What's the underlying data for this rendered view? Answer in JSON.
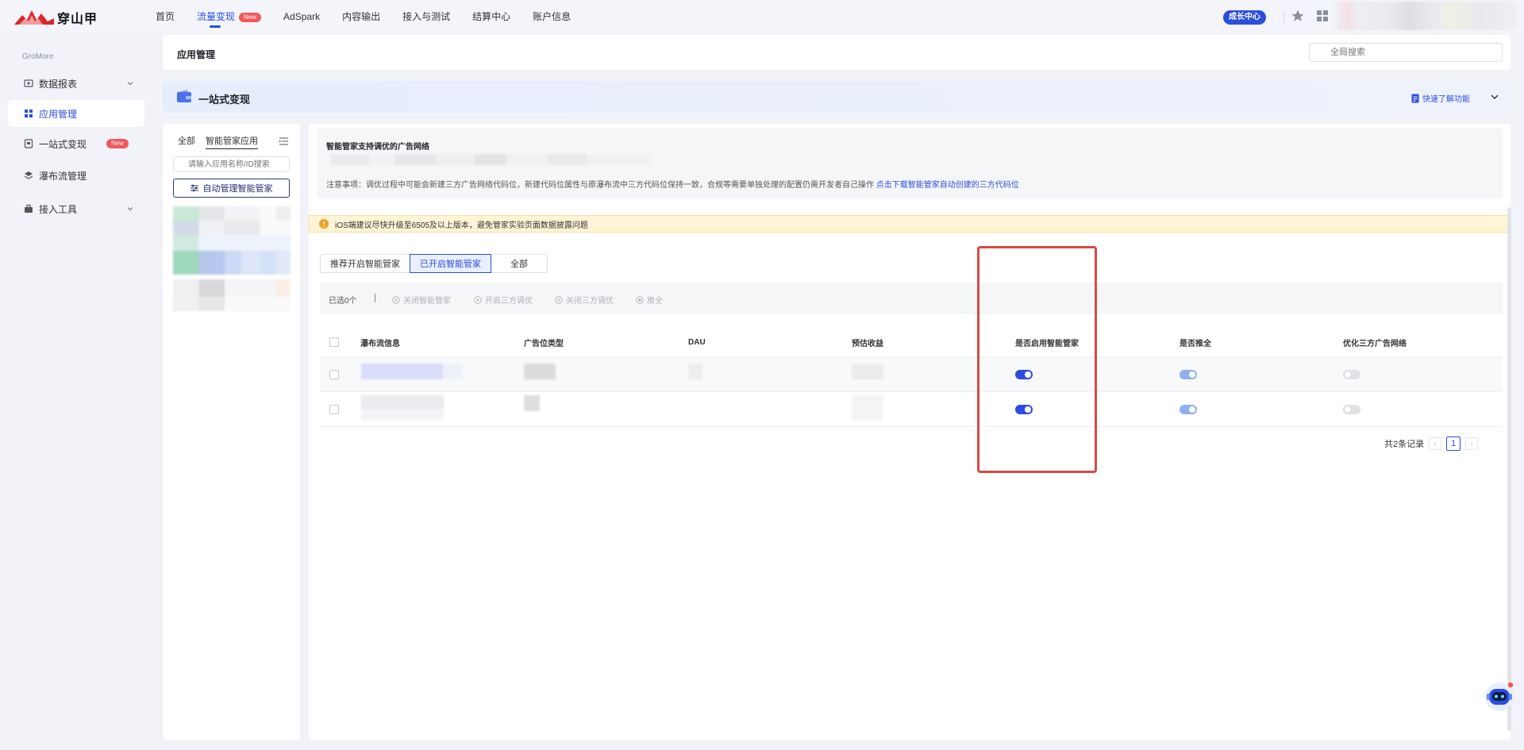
{
  "brand": {
    "name": "穿山甲"
  },
  "nav": {
    "items": [
      "首页",
      "流量变现",
      "AdSpark",
      "内容输出",
      "接入与测试",
      "结算中心",
      "账户信息"
    ],
    "new_badge": "New",
    "growth_center": "成长中心"
  },
  "sidebar": {
    "group": "GroMore",
    "items": [
      {
        "label": "数据报表",
        "icon": "chart-icon"
      },
      {
        "label": "应用管理",
        "icon": "grid-icon"
      },
      {
        "label": "一站式变现",
        "icon": "wallet-icon",
        "badge": "New"
      },
      {
        "label": "瀑布流管理",
        "icon": "layers-icon"
      },
      {
        "label": "接入工具",
        "icon": "toolbox-icon"
      }
    ]
  },
  "header": {
    "title": "应用管理",
    "search_placeholder": "全局搜索"
  },
  "one_stop": {
    "title": "一站式变现",
    "quick_link": "快速了解功能"
  },
  "left_panel": {
    "tabs": [
      "全部",
      "智能管家应用"
    ],
    "search_placeholder": "请输入应用名称/ID搜索",
    "auto_button": "自动管理智能管家"
  },
  "info": {
    "title": "智能管家支持调优的广告网络",
    "note": "注意事项：调优过程中可能会新建三方广告网络代码位，新建代码位属性与原瀑布流中三方代码位保持一致，合规等需要单独处理的配置仍需开发者自己操作",
    "note_link": "点击下载智能管家自动创建的三方代码位"
  },
  "warning": {
    "text": "iOS端建议尽快升级至6505及以上版本，避免管家实验页面数据披露问题"
  },
  "filter_tabs": {
    "items": [
      "推荐开启智能管家",
      "已开启智能管家",
      "全部"
    ],
    "active": 1
  },
  "bulk": {
    "selected": "已选0个",
    "sep": "|",
    "actions": [
      "关闭智能管家",
      "开启三方调优",
      "关闭三方调优",
      "推全"
    ]
  },
  "table": {
    "columns": [
      "瀑布流信息",
      "广告位类型",
      "DAU",
      "预估收益",
      "是否启用智能管家",
      "是否推全",
      "优化三方广告网络"
    ],
    "rows": [
      {
        "smart_manager": "on",
        "push_all": "on-disabled",
        "optimize_third_party": "off"
      },
      {
        "smart_manager": "on",
        "push_all": "on-disabled",
        "optimize_third_party": "off"
      }
    ]
  },
  "pagination": {
    "total": "共2条记录",
    "prev": "‹",
    "page": "1",
    "next": "›"
  },
  "colors": {
    "accent": "#2b4de0",
    "highlight": "#d64a45",
    "warning_bg": "#fff5d6"
  }
}
